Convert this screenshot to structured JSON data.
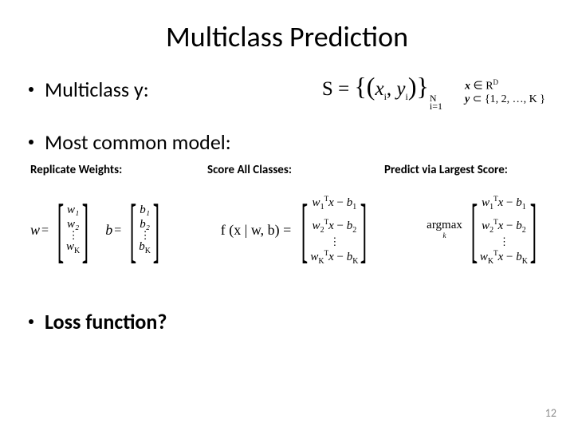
{
  "title": "Multiclass Prediction",
  "bullets": {
    "b1": "Multiclass y:",
    "b2": "Most common model:",
    "b3": "Loss function?"
  },
  "eq": {
    "S_lhs": "S =",
    "pair_open": "{(",
    "xi": "x",
    "comma": ", ",
    "yi": "y",
    "pair_close": ")}",
    "sup_N": "N",
    "sub_i1": "i=1",
    "sub_i": "i"
  },
  "domain": {
    "line1_lhs": "x",
    "line1_in": " ∈ ",
    "line1_rhs": "R",
    "line1_sup": "D",
    "line2_lhs": "y",
    "line2_in": " ⊂ ",
    "line2_rhs": "{1, 2, …, K }"
  },
  "cols": {
    "c1": "Replicate Weights:",
    "c2": "Score All Classes:",
    "c3": "Predict via Largest Score:"
  },
  "vec": {
    "w": "w",
    "b": "b",
    "eq": " = ",
    "w1": "w₁",
    "w2": "w₂",
    "wK": "w_K",
    "b1": "b₁",
    "b2": "b₂",
    "bK": "b_K",
    "vdots": "⋮"
  },
  "score": {
    "lhs": "f (x | w, b) = ",
    "r1_a": "w₁",
    "r1_mid": "x − b₁",
    "r2_a": "w₂",
    "r2_mid": "x − b₂",
    "rK_a": "w_K",
    "rK_mid": "x − b_K",
    "T": "T"
  },
  "argmax": {
    "label": "argmax",
    "sub": "k"
  },
  "page": "12"
}
